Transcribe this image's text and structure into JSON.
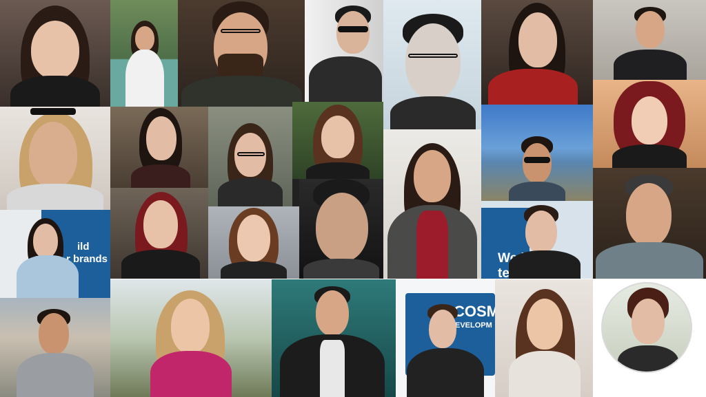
{
  "collage": {
    "tile_count": 27,
    "palette": {
      "skin_light": "#e8c2a8",
      "skin_mid": "#d6a686",
      "skin_tan": "#c9936f",
      "hair_dark": "#2a1b14",
      "hair_brown": "#5a3320",
      "hair_blonde": "#c8a26a",
      "hair_red": "#7a1a1f",
      "brand_blue": "#1d5f9a"
    },
    "signs": {
      "brands_line1": "ild",
      "brands_line2": "r brands",
      "we_line1": "We b",
      "we_line2": "te",
      "cosm_line1": "COSM",
      "cosm_line2": "EVELOPM"
    }
  }
}
